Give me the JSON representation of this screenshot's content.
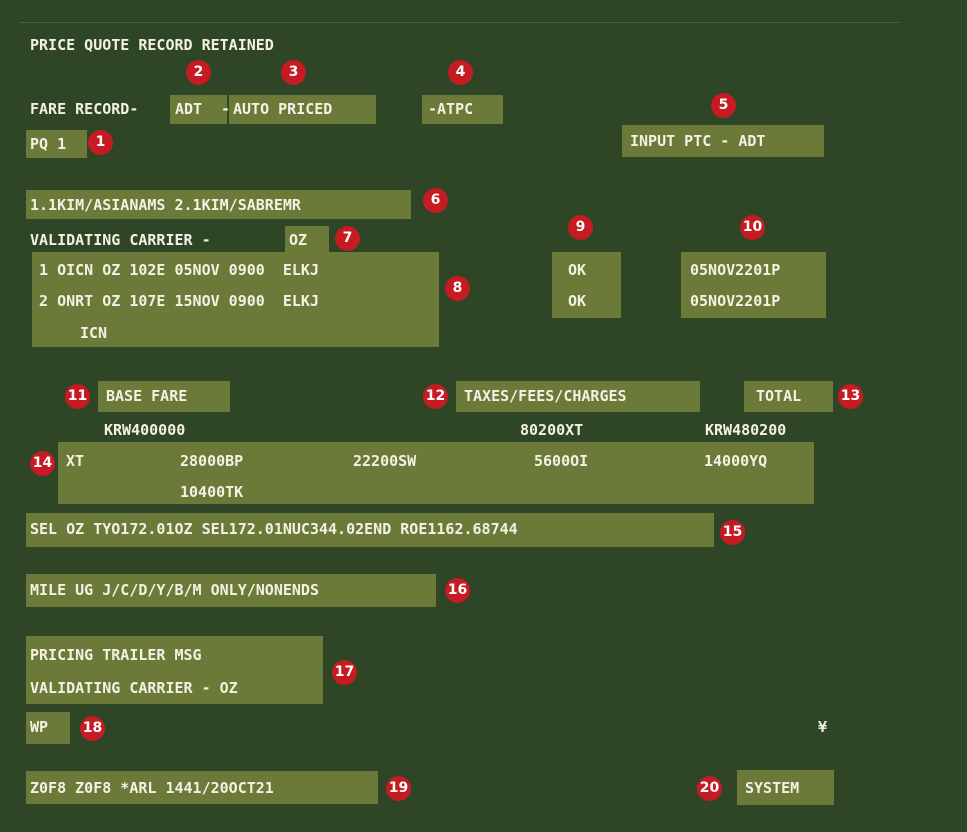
{
  "header": {
    "title": "PRICE QUOTE RECORD RETAINED",
    "fare_record_prefix": "FARE RECORD-",
    "ptc": "ADT",
    "dash": "-",
    "auto_priced": "AUTO PRICED",
    "atpc": "-ATPC",
    "pq": "PQ 1",
    "input_ptc": "INPUT PTC - ADT"
  },
  "passengers": "1.1KIM/ASIANAMS 2.1KIM/SABREMR",
  "validating": {
    "label": "VALIDATING CARRIER - ",
    "carrier": "OZ"
  },
  "segments": [
    {
      "line": " 1 OICN OZ 102E 05NOV 0900  ELKJ",
      "status": "OK",
      "date": "05NOV2201P"
    },
    {
      "line": " 2 ONRT OZ 107E 15NOV 0900  ELKJ",
      "status": "OK",
      "date": "05NOV2201P"
    }
  ],
  "final_city": "ICN",
  "fare": {
    "base_label": "BASE FARE",
    "taxes_label": "TAXES/FEES/CHARGES",
    "total_label": "TOTAL",
    "base_value": "KRW400000",
    "taxes_value": "80200XT",
    "total_value": "KRW480200"
  },
  "xt": {
    "label": "XT",
    "taxes": [
      "28000BP",
      "22200SW",
      "5600OI",
      "14000YQ"
    ],
    "taxes_line2": [
      "10400TK"
    ]
  },
  "fare_calc": "SEL OZ TYO172.01OZ SEL172.01NUC344.02END ROE1162.68744",
  "endorsement": "MILE UG J/C/D/Y/B/M ONLY/NONENDS",
  "trailer": {
    "line1": "PRICING TRAILER MSG",
    "line2": "VALIDATING CARRIER - OZ"
  },
  "command": "WP",
  "cursor_symbol": "¥",
  "footer": {
    "agent_line": "Z0F8 Z0F8 *ARL 1441/20OCT21",
    "system": "SYSTEM"
  },
  "callouts": [
    "1",
    "2",
    "3",
    "4",
    "5",
    "6",
    "7",
    "8",
    "9",
    "10",
    "11",
    "12",
    "13",
    "14",
    "15",
    "16",
    "17",
    "18",
    "19",
    "20"
  ],
  "colors": {
    "background": "#2e4626",
    "highlight": "#6b7a38",
    "text": "#f4f1e4",
    "callout": "#c61b22"
  }
}
